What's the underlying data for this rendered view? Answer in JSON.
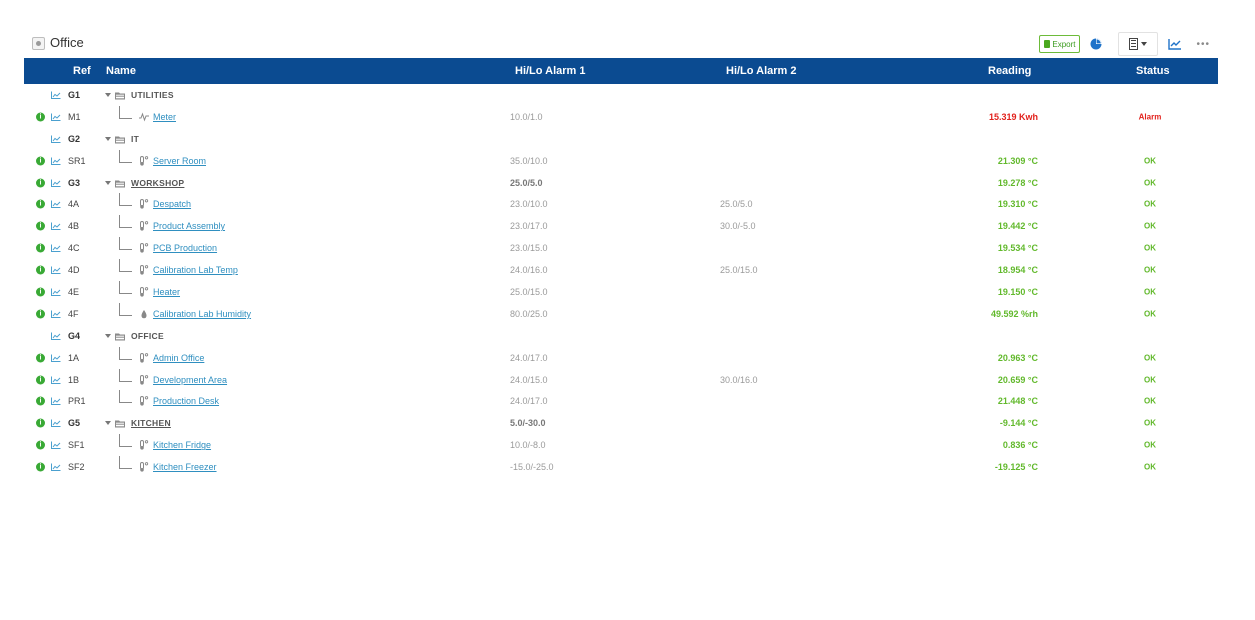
{
  "page": {
    "title": "Office"
  },
  "toolbar": {
    "export_label": "Export"
  },
  "columns": {
    "ref": "Ref",
    "name": "Name",
    "alarm1": "Hi/Lo Alarm 1",
    "alarm2": "Hi/Lo Alarm 2",
    "reading": "Reading",
    "status": "Status"
  },
  "colors": {
    "header_bg": "#0b4b91",
    "ok": "#62b92c",
    "alarm": "#e2211c",
    "link": "#2f8fc0"
  },
  "rows": [
    {
      "type": "group",
      "ref": "G1",
      "name": "UTILITIES",
      "alarm1": "",
      "alarm2": "",
      "reading": "",
      "status": "",
      "info": false
    },
    {
      "type": "item",
      "ref": "M1",
      "name": "Meter",
      "icon": "pulse-icon",
      "alarm1": "10.0/1.0",
      "alarm2": "",
      "reading": "15.319 Kwh",
      "status": "Alarm",
      "state": "alarm",
      "info": true
    },
    {
      "type": "group",
      "ref": "G2",
      "name": "IT",
      "alarm1": "",
      "alarm2": "",
      "reading": "",
      "status": "",
      "info": false
    },
    {
      "type": "item",
      "ref": "SR1",
      "name": "Server Room",
      "icon": "thermometer-icon",
      "alarm1": "35.0/10.0",
      "alarm2": "",
      "reading": "21.309 °C",
      "status": "OK",
      "state": "ok",
      "info": true
    },
    {
      "type": "group",
      "ref": "G3",
      "name": "WORKSHOP",
      "alarm1": "25.0/5.0",
      "alarm2": "",
      "reading": "19.278 °C",
      "status": "OK",
      "state": "ok",
      "info": true,
      "underline": true
    },
    {
      "type": "item",
      "ref": "4A",
      "name": "Despatch",
      "icon": "thermometer-icon",
      "alarm1": "23.0/10.0",
      "alarm2": "25.0/5.0",
      "reading": "19.310 °C",
      "status": "OK",
      "state": "ok",
      "info": true
    },
    {
      "type": "item",
      "ref": "4B",
      "name": "Product Assembly",
      "icon": "thermometer-icon",
      "alarm1": "23.0/17.0",
      "alarm2": "30.0/-5.0",
      "reading": "19.442 °C",
      "status": "OK",
      "state": "ok",
      "info": true
    },
    {
      "type": "item",
      "ref": "4C",
      "name": "PCB Production",
      "icon": "thermometer-icon",
      "alarm1": "23.0/15.0",
      "alarm2": "",
      "reading": "19.534 °C",
      "status": "OK",
      "state": "ok",
      "info": true
    },
    {
      "type": "item",
      "ref": "4D",
      "name": "Calibration Lab Temp",
      "icon": "thermometer-icon",
      "alarm1": "24.0/16.0",
      "alarm2": "25.0/15.0",
      "reading": "18.954 °C",
      "status": "OK",
      "state": "ok",
      "info": true
    },
    {
      "type": "item",
      "ref": "4E",
      "name": "Heater",
      "icon": "thermometer-icon",
      "alarm1": "25.0/15.0",
      "alarm2": "",
      "reading": "19.150 °C",
      "status": "OK",
      "state": "ok",
      "info": true
    },
    {
      "type": "item",
      "ref": "4F",
      "name": "Calibration Lab Humidity",
      "icon": "droplet-icon",
      "alarm1": "80.0/25.0",
      "alarm2": "",
      "reading": "49.592 %rh",
      "status": "OK",
      "state": "ok",
      "info": true
    },
    {
      "type": "group",
      "ref": "G4",
      "name": "OFFICE",
      "alarm1": "",
      "alarm2": "",
      "reading": "",
      "status": "",
      "info": false
    },
    {
      "type": "item",
      "ref": "1A",
      "name": "Admin Office",
      "icon": "thermometer-icon",
      "alarm1": "24.0/17.0",
      "alarm2": "",
      "reading": "20.963 °C",
      "status": "OK",
      "state": "ok",
      "info": true
    },
    {
      "type": "item",
      "ref": "1B",
      "name": "Development Area",
      "icon": "thermometer-icon",
      "alarm1": "24.0/15.0",
      "alarm2": "30.0/16.0",
      "reading": "20.659 °C",
      "status": "OK",
      "state": "ok",
      "info": true
    },
    {
      "type": "item",
      "ref": "PR1",
      "name": "Production Desk",
      "icon": "thermometer-icon",
      "alarm1": "24.0/17.0",
      "alarm2": "",
      "reading": "21.448 °C",
      "status": "OK",
      "state": "ok",
      "info": true
    },
    {
      "type": "group",
      "ref": "G5",
      "name": "KITCHEN",
      "alarm1": "5.0/-30.0",
      "alarm2": "",
      "reading": "-9.144 °C",
      "status": "OK",
      "state": "ok",
      "info": true,
      "underline": true
    },
    {
      "type": "item",
      "ref": "SF1",
      "name": "Kitchen Fridge",
      "icon": "thermometer-icon",
      "alarm1": "10.0/-8.0",
      "alarm2": "",
      "reading": "0.836 °C",
      "status": "OK",
      "state": "ok",
      "info": true
    },
    {
      "type": "item",
      "ref": "SF2",
      "name": "Kitchen Freezer",
      "icon": "thermometer-icon",
      "alarm1": "-15.0/-25.0",
      "alarm2": "",
      "reading": "-19.125 °C",
      "status": "OK",
      "state": "ok",
      "info": true
    }
  ]
}
